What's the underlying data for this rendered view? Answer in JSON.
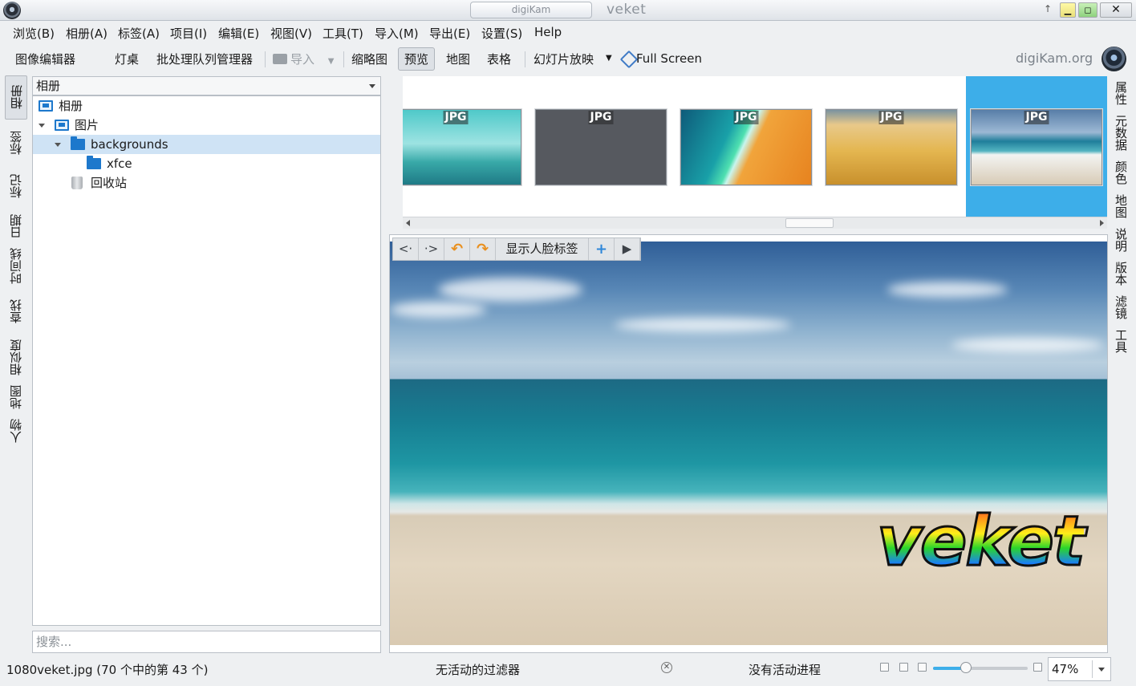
{
  "window": {
    "tab_title": "digiKam",
    "title": "veket"
  },
  "menu": [
    "浏览(B)",
    "相册(A)",
    "标签(A)",
    "项目(I)",
    "编辑(E)",
    "视图(V)",
    "工具(T)",
    "导入(M)",
    "导出(E)",
    "设置(S)",
    "Help"
  ],
  "toolbar": {
    "image_editor": "图像编辑器",
    "light_table": "灯桌",
    "batch_queue": "批处理队列管理器",
    "import": "导入",
    "thumbnails": "缩略图",
    "preview": "预览",
    "map": "地图",
    "table": "表格",
    "slideshow": "幻灯片放映",
    "fullscreen": "Full Screen",
    "brand": "digiKam.org"
  },
  "left_tabs": [
    "相册",
    "标签",
    "标记",
    "日期",
    "时间线",
    "查找",
    "相似度",
    "地图",
    "人物"
  ],
  "right_tabs": [
    "属性",
    "元数据",
    "颜色",
    "地图",
    "说明",
    "版本",
    "滤镜",
    "工具"
  ],
  "album_panel": {
    "combo": "相册",
    "tree": {
      "root": "相册",
      "pictures": "图片",
      "backgrounds": "backgrounds",
      "xfce": "xfce",
      "trash": "回收站"
    },
    "search_placeholder": "搜索..."
  },
  "thumbnails": [
    {
      "badge": "JPG"
    },
    {
      "badge": "JPG"
    },
    {
      "badge": "JPG"
    },
    {
      "badge": "JPG"
    },
    {
      "badge": "JPG",
      "selected": true
    }
  ],
  "preview": {
    "show_face_tags": "显示人脸标签",
    "watermark": "veket"
  },
  "status": {
    "file_info": "1080veket.jpg (70 个中的第 43 个)",
    "filter": "无活动的过滤器",
    "progress": "没有活动进程",
    "zoom": "47%",
    "zoom_fraction": 0.35
  },
  "colors": {
    "accent": "#3daee9",
    "folder": "#1d78cc",
    "selection_row": "#cfe3f5"
  }
}
